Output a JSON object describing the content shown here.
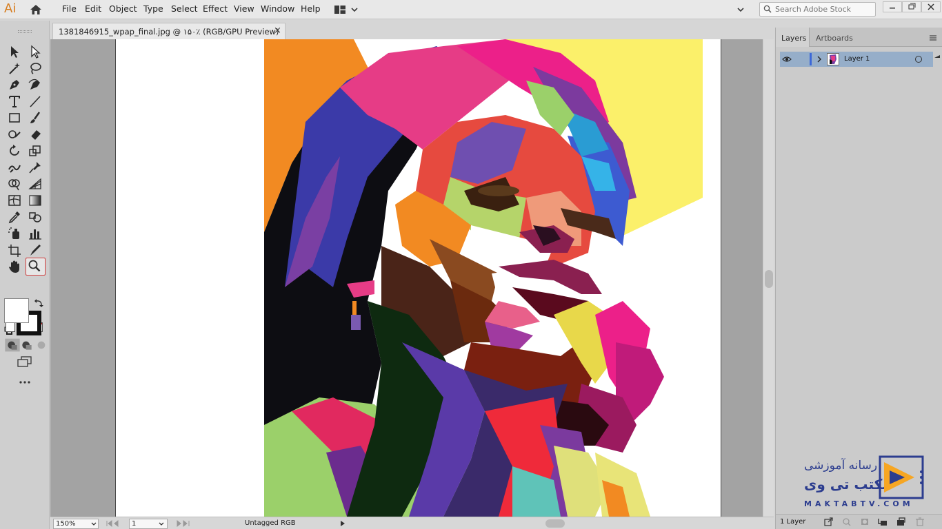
{
  "app": {
    "logo": "Ai"
  },
  "menu": [
    "File",
    "Edit",
    "Object",
    "Type",
    "Select",
    "Effect",
    "View",
    "Window",
    "Help"
  ],
  "search": {
    "placeholder": "Search Adobe Stock"
  },
  "document": {
    "tab_title": "1381846915_wpap_final.jpg  @  ۱۵۰٪ (RGB/GPU Preview)",
    "close": "×"
  },
  "status": {
    "zoom": "150%",
    "page": "1",
    "profile": "Untagged RGB"
  },
  "panel": {
    "tabs": [
      "Layers",
      "Artboards"
    ],
    "layers": [
      {
        "name": "Layer 1",
        "visible": true,
        "color": "#3c68d8"
      }
    ],
    "count": "1 Layer"
  },
  "toolbar": {
    "selected_tool": "zoom-tool",
    "fill_color": "#ffffff",
    "stroke_color": "#111111"
  },
  "watermark": {
    "line1": "رسانه آموزشی",
    "line2": "مکتب تی وی",
    "line3": "MAKTABTV.COM"
  },
  "colors": {
    "accent": "#d77c1d",
    "layer_row": "#96aec9",
    "watermark": "#2c3d8f"
  }
}
